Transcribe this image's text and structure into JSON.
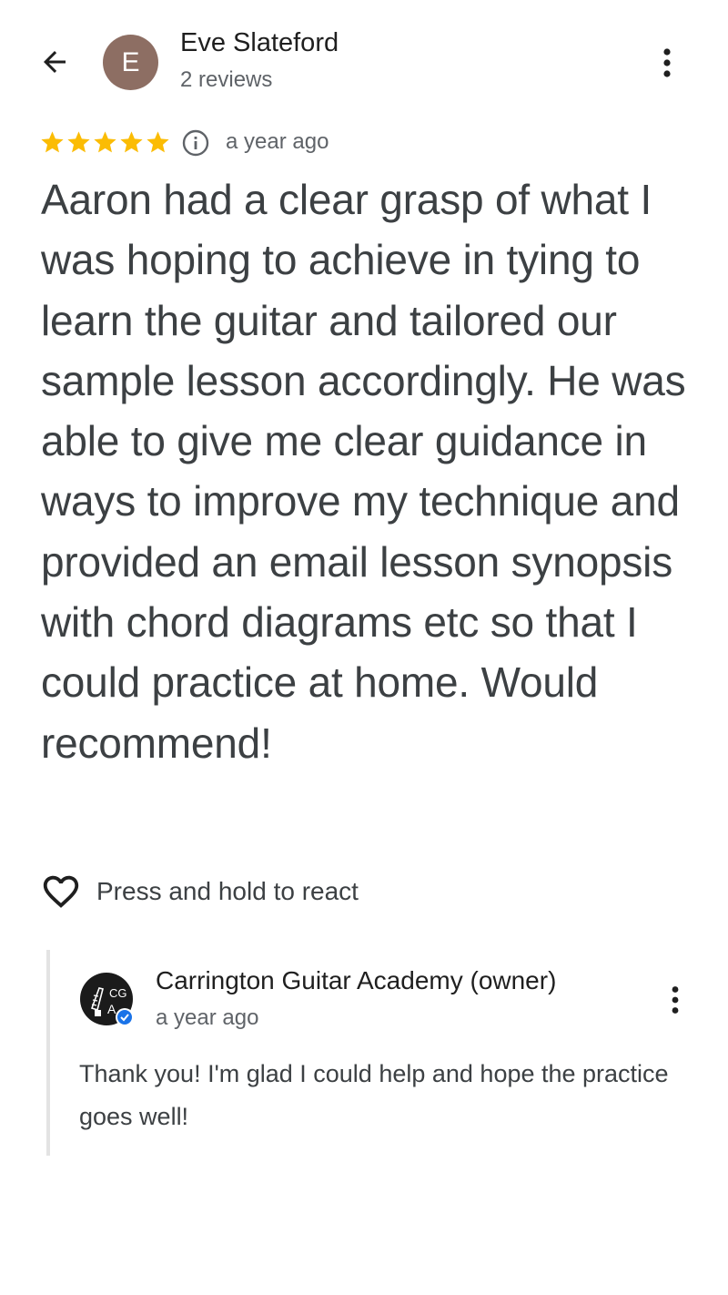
{
  "header": {
    "back_icon": "arrow-back-icon",
    "avatar_initial": "E",
    "avatar_color": "#8d6e63",
    "reviewer_name": "Eve Slateford",
    "review_count": "2 reviews",
    "more_icon": "more-vertical-icon"
  },
  "rating": {
    "stars": 5,
    "star_color": "#fbbc04",
    "info_icon": "info-icon",
    "time": "a year ago"
  },
  "review": {
    "text": "Aaron had a clear grasp of what I was hoping to achieve in tying to learn the guitar and tailored our sample lesson accordingly. He was able to give me clear guidance in ways to improve my technique and provided an email lesson synopsis with chord diagrams etc so that I could practice at home. Would recommend!"
  },
  "react": {
    "icon": "heart-outline-icon",
    "label": "Press and hold to react"
  },
  "owner_reply": {
    "logo_text_top": "CG",
    "logo_text_bottom": "A",
    "verified_color": "#1a73e8",
    "name": "Carrington Guitar Academy (owner)",
    "time": "a year ago",
    "text": "Thank you! I'm glad I could help and hope the practice goes well!",
    "more_icon": "more-vertical-icon"
  }
}
